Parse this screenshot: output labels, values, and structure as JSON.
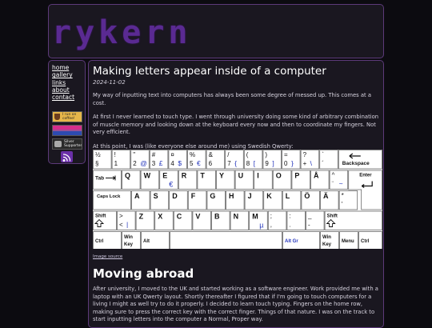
{
  "header": {
    "logo_text": "rykern"
  },
  "sidebar": {
    "links": [
      "home",
      "gallery",
      "links",
      "about",
      "contact"
    ],
    "badges": {
      "coffee": "I run on coffee!",
      "silver": "Silver Supporter"
    }
  },
  "post": {
    "title": "Making letters appear inside of a computer",
    "date": "2024-11-02",
    "p1": "My way of inputting text into computers has always been some degree of messed up. This comes at a cost.",
    "p2": "At first I never learned to touch type. I went through university doing some kind of arbitrary combination of muscle memory and looking down at the keyboard every now and then to coordinate my fingers. Not very efficient.",
    "p3": "At this point, I was (like everyone else around me) using Swedish Qwerty:",
    "image_source": "Image source",
    "h2": "Moving abroad",
    "p4": "After university, I moved to the UK and started working as a software engineer. Work provided me with a laptop with an UK Qwerty layout. Shortly thereafter I figured that if I'm going to touch computers for a living I might as well try to do it properly. I decided to learn touch typing. Fingers on the home row, making sure to press the correct key with the correct finger. Things of that nature. I was on the track to start inputting letters into the computer a Normal, Proper way."
  },
  "keyboard": {
    "row1": [
      {
        "t": "½",
        "b": "§"
      },
      {
        "t": "!",
        "b": "1"
      },
      {
        "t": "\"",
        "b": "2",
        "r": "@"
      },
      {
        "t": "#",
        "b": "3",
        "r": "£"
      },
      {
        "t": "¤",
        "b": "4",
        "r": "$"
      },
      {
        "t": "%",
        "b": "5",
        "r": "€"
      },
      {
        "t": "&",
        "b": "6"
      },
      {
        "t": "/",
        "b": "7",
        "r": "{"
      },
      {
        "t": "(",
        "b": "8",
        "r": "["
      },
      {
        "t": ")",
        "b": "9",
        "r": "]"
      },
      {
        "t": "=",
        "b": "0",
        "r": "}"
      },
      {
        "t": "?",
        "b": "+",
        "r": "\\"
      },
      {
        "t": "`",
        "b": "´"
      }
    ],
    "backspace": "Backspace",
    "tab": "Tab",
    "row2": [
      "Q",
      "W",
      "E",
      "R",
      "T",
      "Y",
      "U",
      "I",
      "O",
      "P",
      "Å"
    ],
    "row2_e_alt": "€",
    "row2_last": {
      "t": "^",
      "b": "¨",
      "r": "~"
    },
    "enter": "Enter",
    "caps": "Caps Lock",
    "row3": [
      "A",
      "S",
      "D",
      "F",
      "G",
      "H",
      "J",
      "K",
      "L",
      "Ö",
      "Ä"
    ],
    "row3_last": {
      "t": "*",
      "b": "'"
    },
    "shift": "Shift",
    "lt": {
      "t": ">",
      "b": "<",
      "r": "|"
    },
    "row4": [
      "Z",
      "X",
      "C",
      "V",
      "B",
      "N",
      "M"
    ],
    "m_alt": "µ",
    "row4_punct": [
      {
        "t": ";",
        "b": ","
      },
      {
        "t": ":",
        "b": "."
      },
      {
        "t": "_",
        "b": "-"
      }
    ],
    "ctrl": "Ctrl",
    "win_key": "Win Key",
    "alt": "Alt",
    "altgr": "Alt Gr",
    "menu": "Menu",
    "colors": {
      "key_fill": "#ffffff",
      "key_stroke": "#666666",
      "altgr_color": "#2233bb",
      "accent": "#5c3a7a"
    }
  }
}
